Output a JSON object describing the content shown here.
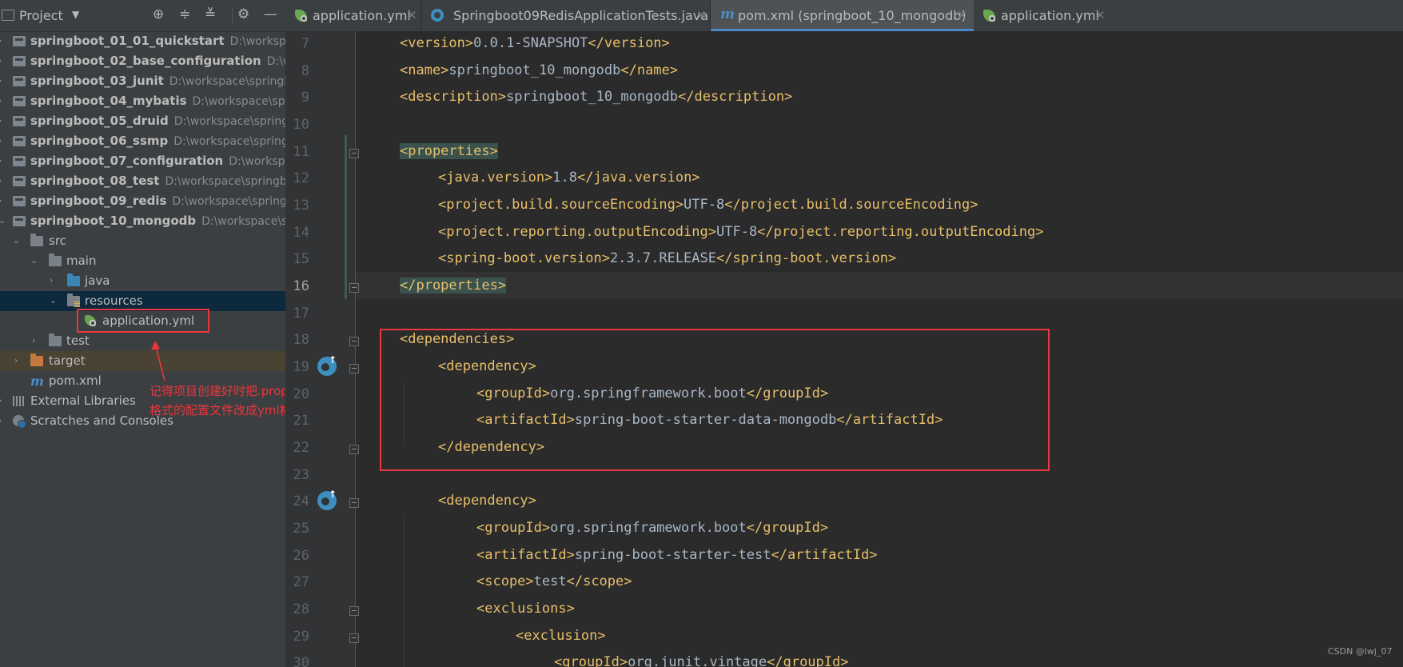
{
  "project_panel": {
    "title": "Project",
    "dropdown": "▼",
    "toolbar_icons": [
      "target-icon",
      "expand-all-icon",
      "collapse-all-icon",
      "gear-icon",
      "minimize-icon"
    ],
    "tree": [
      {
        "label": "springboot_01_01_quickstart",
        "path": "D:\\workspace"
      },
      {
        "label": "springboot_02_base_configuration",
        "path": "D:\\work"
      },
      {
        "label": "springboot_03_junit",
        "path": "D:\\workspace\\springb"
      },
      {
        "label": "springboot_04_mybatis",
        "path": "D:\\workspace\\sprin"
      },
      {
        "label": "springboot_05_druid",
        "path": "D:\\workspace\\springb"
      },
      {
        "label": "springboot_06_ssmp",
        "path": "D:\\workspace\\springb"
      },
      {
        "label": "springboot_07_configuration",
        "path": "D:\\workspace"
      },
      {
        "label": "springboot_08_test",
        "path": "D:\\workspace\\springbo"
      },
      {
        "label": "springboot_09_redis",
        "path": "D:\\workspace\\springb"
      },
      {
        "label": "springboot_10_mongodb",
        "path": "D:\\workspace\\sp"
      },
      {
        "label": "src"
      },
      {
        "label": "main"
      },
      {
        "label": "java"
      },
      {
        "label": "resources"
      },
      {
        "label": "application.yml"
      },
      {
        "label": "test"
      },
      {
        "label": "target"
      },
      {
        "label": "pom.xml"
      },
      {
        "label": "External Libraries"
      },
      {
        "label": "Scratches and Consoles"
      }
    ],
    "annotation": {
      "line1": "记得项目创建好时把.properties",
      "line2": "格式的配置文件改成yml格式"
    }
  },
  "tabs": [
    {
      "label": "application.yml",
      "icon": "spring-yml-icon",
      "close": "✕"
    },
    {
      "label": "Springboot09RedisApplicationTests.java",
      "icon": "test-class-icon",
      "close": "✕"
    },
    {
      "label": "pom.xml (springboot_10_mongodb)",
      "icon": "maven-icon",
      "close": "✕",
      "active": true
    },
    {
      "label": "application.yml",
      "icon": "spring-yml-icon",
      "close": "✕"
    }
  ],
  "editor": {
    "line_numbers": [
      "7",
      "8",
      "9",
      "10",
      "11",
      "12",
      "13",
      "14",
      "15",
      "16",
      "17",
      "18",
      "19",
      "20",
      "21",
      "22",
      "23",
      "24",
      "25",
      "26",
      "27",
      "28",
      "29",
      "30"
    ],
    "current_line": "16",
    "lines": [
      {
        "open": "<version>",
        "text": "0.0.1-SNAPSHOT",
        "close": "</version>"
      },
      {
        "open": "<name>",
        "text": "springboot_10_mongodb",
        "close": "</name>"
      },
      {
        "open": "<description>",
        "text": "springboot_10_mongodb",
        "close": "</description>"
      },
      {
        "open": "",
        "text": "",
        "close": ""
      },
      {
        "open": "<properties>",
        "text": "",
        "close": ""
      },
      {
        "open": "<java.version>",
        "text": "1.8",
        "close": "</java.version>"
      },
      {
        "open": "<project.build.sourceEncoding>",
        "text": "UTF-8",
        "close": "</project.build.sourceEncoding>"
      },
      {
        "open": "<project.reporting.outputEncoding>",
        "text": "UTF-8",
        "close": "</project.reporting.outputEncoding>"
      },
      {
        "open": "<spring-boot.version>",
        "text": "2.3.7.RELEASE",
        "close": "</spring-boot.version>"
      },
      {
        "open": "</properties>",
        "text": "",
        "close": ""
      },
      {
        "open": "",
        "text": "",
        "close": ""
      },
      {
        "open": "<dependencies>",
        "text": "",
        "close": ""
      },
      {
        "open": "<dependency>",
        "text": "",
        "close": ""
      },
      {
        "open": "<groupId>",
        "text": "org.springframework.boot",
        "close": "</groupId>"
      },
      {
        "open": "<artifactId>",
        "text": "spring-boot-starter-data-mongodb",
        "close": "</artifactId>"
      },
      {
        "open": "</dependency>",
        "text": "",
        "close": ""
      },
      {
        "open": "",
        "text": "",
        "close": ""
      },
      {
        "open": "<dependency>",
        "text": "",
        "close": ""
      },
      {
        "open": "<groupId>",
        "text": "org.springframework.boot",
        "close": "</groupId>"
      },
      {
        "open": "<artifactId>",
        "text": "spring-boot-starter-test",
        "close": "</artifactId>"
      },
      {
        "open": "<scope>",
        "text": "test",
        "close": "</scope>"
      },
      {
        "open": "<exclusions>",
        "text": "",
        "close": ""
      },
      {
        "open": "<exclusion>",
        "text": "",
        "close": ""
      },
      {
        "open": "<groupId>",
        "text": "org.junit.vintage",
        "close": "</groupId>"
      }
    ]
  },
  "watermark": "CSDN @lwj_07"
}
